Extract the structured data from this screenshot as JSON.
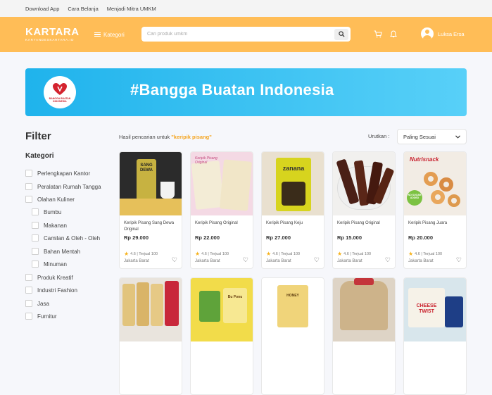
{
  "topbar": {
    "links": [
      "Download App",
      "Cara Belanja",
      "Menjadi Mitra UMKM"
    ]
  },
  "header": {
    "logo": "KARTARA",
    "logo_sub": "KARYANDESKARTARA.ID",
    "kategori": "Kategori",
    "search_placeholder": "Cari produk umkm",
    "user_name": "Luksa Ersa"
  },
  "banner": {
    "badge_text": "BANGGA BUATAN INDONESIA",
    "headline": "#Bangga Buatan Indonesia"
  },
  "filter": {
    "title": "Filter",
    "kategori_title": "Kategori",
    "items": [
      "Perlengkapan Kantor",
      "Peralatan Rumah Tangga",
      "Olahan Kuliner",
      "Bumbu",
      "Makanan",
      "Camilan & Oleh - Oleh",
      "Bahan Mentah",
      "Minuman",
      "Produk Kreatif",
      "Industri Fashion",
      "Jasa",
      "Furnitur"
    ]
  },
  "results": {
    "prefix": "Hasil pencarian untuk",
    "query": "\"keripik pisang\"",
    "sort_label": "Urutkan :",
    "sort_value": "Paling Sesuai"
  },
  "products": [
    {
      "name": "Keripik Pisang Sang Dewa Original",
      "price": "Rp 29.000",
      "rating": "4.6 | Terjual 100",
      "location": "Jakarta Barat"
    },
    {
      "name": "Keripik Pisang Original",
      "price": "Rp 22.000",
      "rating": "4.6 | Terjual 100",
      "location": "Jakarta Barat"
    },
    {
      "name": "Keripik Pisang Keju",
      "price": "Rp 27.000",
      "rating": "4.6 | Terjual 100",
      "location": "Jakarta Barat"
    },
    {
      "name": "Keripik Pisang Original",
      "price": "Rp 15.000",
      "rating": "4.6 | Terjual 100",
      "location": "Jakarta Barat"
    },
    {
      "name": "Keripik Pisang Juara",
      "price": "Rp 20.000",
      "rating": "4.6 | Terjual 100",
      "location": "Jakarta Barat"
    }
  ],
  "product_image_text": {
    "p1": "SANG DEWA",
    "p2": "Keripik Pisang Original",
    "p3": "zanana",
    "p5_brand": "Nutrisnack",
    "p5_badge": "NO SUGAR ADDED"
  },
  "row2_image_text": {
    "r2": "Bu Ponu",
    "r3": "HONEY",
    "r5": "CHEESE TWIST"
  },
  "icons": [
    "hamburger-icon",
    "search-icon",
    "cart-icon",
    "bell-icon",
    "star-icon",
    "heart-icon",
    "chevron-down-icon"
  ],
  "colors": {
    "header": "#ffbd57",
    "banner": "#1fb3ec",
    "accent": "#f5a623"
  }
}
